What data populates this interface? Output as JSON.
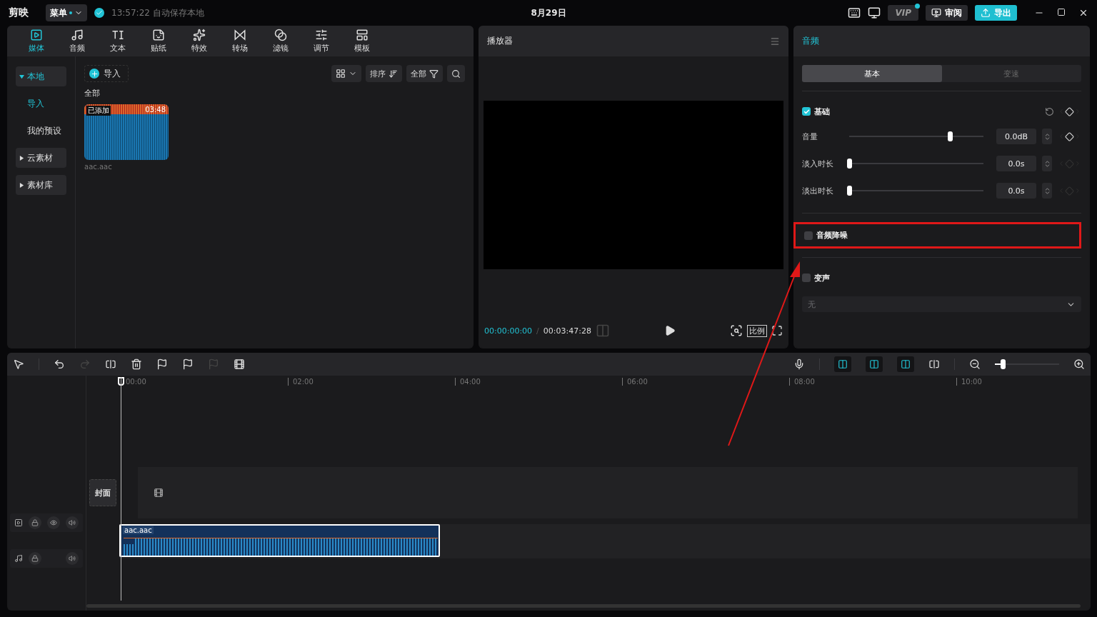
{
  "app": {
    "name": "剪映",
    "menu": "菜单",
    "save_status": "13:57:22 自动保存本地",
    "title": "8月29日",
    "vip": "VIP",
    "review": "审阅",
    "export": "导出"
  },
  "media_tabs": [
    {
      "label": "媒体",
      "selected": true
    },
    {
      "label": "音频",
      "selected": false
    },
    {
      "label": "文本",
      "selected": false
    },
    {
      "label": "贴纸",
      "selected": false
    },
    {
      "label": "特效",
      "selected": false
    },
    {
      "label": "转场",
      "selected": false
    },
    {
      "label": "滤镜",
      "selected": false
    },
    {
      "label": "调节",
      "selected": false
    },
    {
      "label": "模板",
      "selected": false
    }
  ],
  "sidebar": [
    {
      "label": "本地",
      "kind": "group",
      "expanded": true,
      "selected": true
    },
    {
      "label": "导入",
      "kind": "item",
      "selected": true
    },
    {
      "label": "我的预设",
      "kind": "item",
      "selected": false
    },
    {
      "label": "云素材",
      "kind": "group",
      "expanded": false,
      "selected": false
    },
    {
      "label": "素材库",
      "kind": "group",
      "expanded": false,
      "selected": false
    }
  ],
  "media": {
    "import": "导入",
    "sort": "排序",
    "filter": "全部",
    "section": "全部",
    "clips": [
      {
        "badge": "已添加",
        "duration": "03:48",
        "name": "aac.aac"
      }
    ]
  },
  "player": {
    "title": "播放器",
    "current": "00:00:00:00",
    "separator": "/",
    "total": "00:03:47:28",
    "ratio": "比例"
  },
  "inspector": {
    "title": "音频",
    "tabs": [
      {
        "label": "基本",
        "selected": true
      },
      {
        "label": "变速",
        "selected": false
      }
    ],
    "basic": {
      "label": "基础",
      "checked": true
    },
    "rows": [
      {
        "label": "音量",
        "value": "0.0dB",
        "level": 0.75,
        "keyframe": true
      },
      {
        "label": "淡入时长",
        "value": "0.0s",
        "level": 0,
        "keyframe": false
      },
      {
        "label": "淡出时长",
        "value": "0.0s",
        "level": 0,
        "keyframe": false
      }
    ],
    "noise": {
      "label": "音频降噪",
      "checked": false,
      "highlighted": true
    },
    "voice": {
      "label": "变声",
      "checked": false,
      "dropdown": "无"
    }
  },
  "timeline": {
    "ticks": [
      "00:00",
      "02:00",
      "04:00",
      "06:00",
      "08:00",
      "10:00"
    ],
    "zoom": {
      "level": 0.12
    },
    "cover": "封面",
    "audio_clip": "aac.aac"
  }
}
